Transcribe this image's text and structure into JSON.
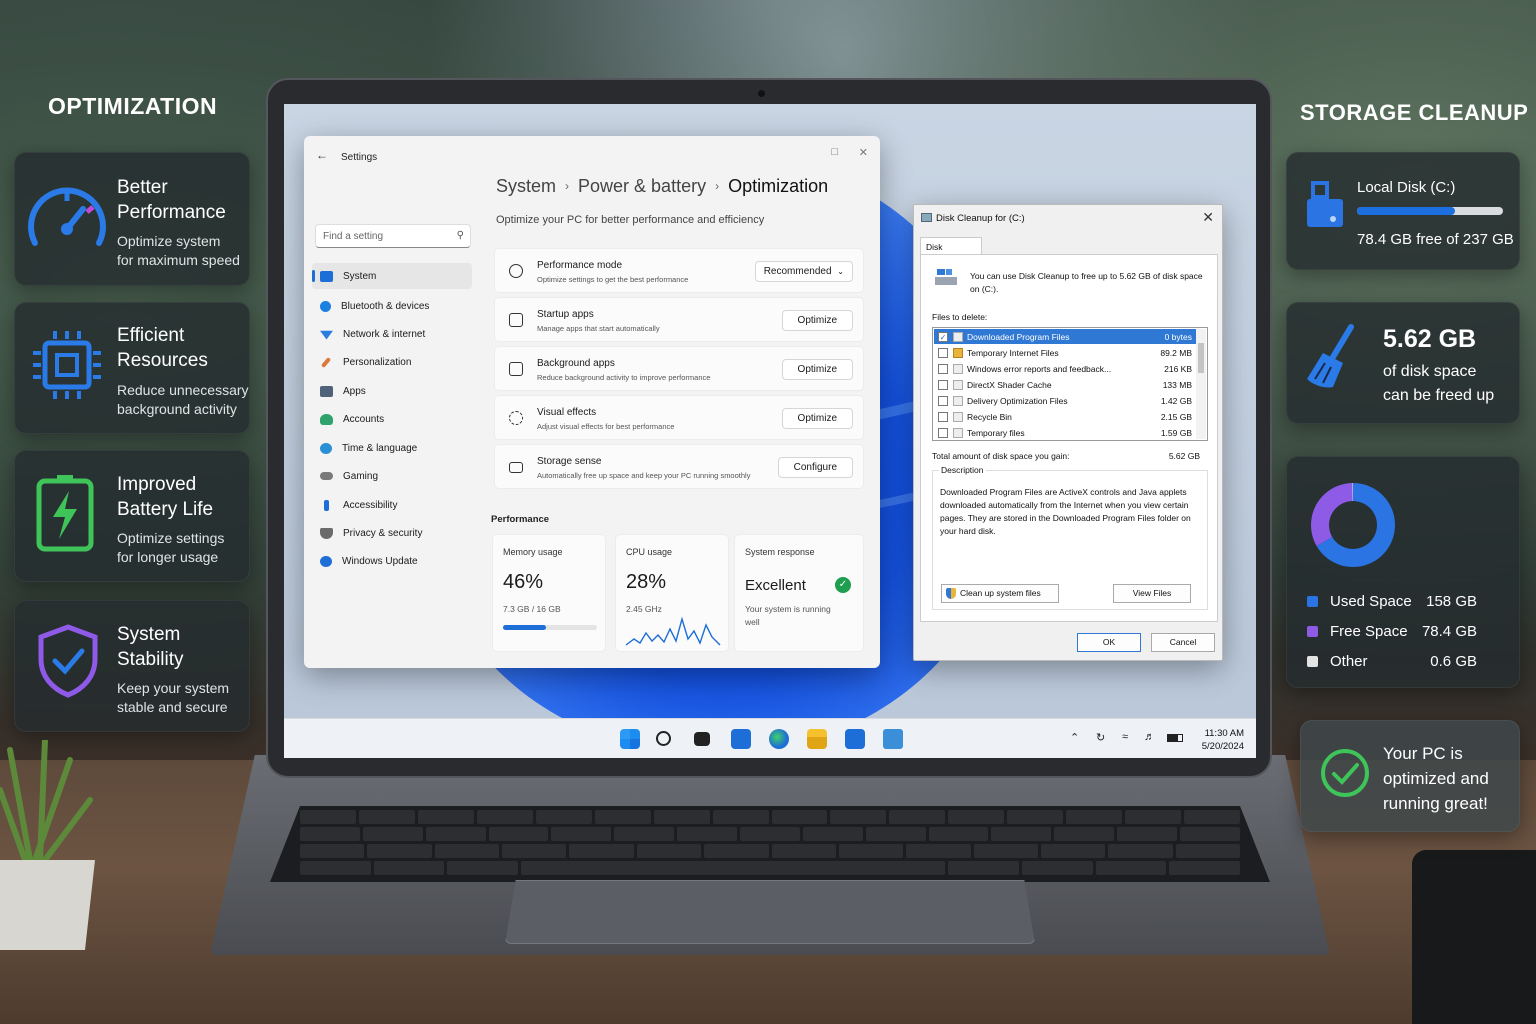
{
  "left_panel": {
    "title": "OPTIMIZATION",
    "cards": [
      {
        "title_line1": "Better",
        "title_line2": "Performance",
        "sub_line1": "Optimize system",
        "sub_line2": "for maximum speed",
        "icon": "speedometer-icon"
      },
      {
        "title_line1": "Efficient",
        "title_line2": "Resources",
        "sub_line1": "Reduce unnecessary",
        "sub_line2": "background activity",
        "icon": "cpu-chip-icon"
      },
      {
        "title_line1": "Improved",
        "title_line2": "Battery Life",
        "sub_line1": "Optimize settings",
        "sub_line2": "for longer usage",
        "icon": "battery-bolt-icon"
      },
      {
        "title_line1": "System",
        "title_line2": "Stability",
        "sub_line1": "Keep your system",
        "sub_line2": "stable and secure",
        "icon": "shield-check-icon"
      }
    ]
  },
  "right_panel": {
    "title": "STORAGE CLEANUP",
    "local_disk": {
      "label": "Local Disk (C:)",
      "used_fraction": 0.67,
      "free_text": "78.4 GB free of 237 GB"
    },
    "freeable": {
      "amount": "5.62 GB",
      "line1": "of disk space",
      "line2": "can be freed up"
    },
    "donut": {
      "legend": [
        {
          "name": "Used Space",
          "value": "158 GB",
          "gb": 158,
          "color": "#2a74e4"
        },
        {
          "name": "Free Space",
          "value": "78.4 GB",
          "gb": 78.4,
          "color": "#8d5be6"
        },
        {
          "name": "Other",
          "value": "0.6 GB",
          "gb": 0.6,
          "color": "#e3e3e3"
        }
      ]
    },
    "status": {
      "line1": "Your PC is",
      "line2": "optimized and",
      "line3": "running great!"
    }
  },
  "settings": {
    "window_title": "Settings",
    "search_placeholder": "Find a setting",
    "nav": [
      {
        "label": "System",
        "color": "#1d6ed6"
      },
      {
        "label": "Bluetooth & devices",
        "color": "#1d7fe0"
      },
      {
        "label": "Network & internet",
        "color": "#2b7de0"
      },
      {
        "label": "Personalization",
        "color": "#d97a3a"
      },
      {
        "label": "Apps",
        "color": "#50617a"
      },
      {
        "label": "Accounts",
        "color": "#2fa36b"
      },
      {
        "label": "Time & language",
        "color": "#2b8fd6"
      },
      {
        "label": "Gaming",
        "color": "#7a7a7a"
      },
      {
        "label": "Accessibility",
        "color": "#1d6ed6"
      },
      {
        "label": "Privacy & security",
        "color": "#6b6b6b"
      },
      {
        "label": "Windows Update",
        "color": "#1d6ed6"
      }
    ],
    "breadcrumb": {
      "a": "System",
      "b": "Power & battery",
      "c": "Optimization"
    },
    "subtitle": "Optimize your PC for better performance and efficiency",
    "rows": [
      {
        "title": "Performance mode",
        "sub": "Optimize settings to get the best performance",
        "button": "Recommended"
      },
      {
        "title": "Startup apps",
        "sub": "Manage apps that start automatically",
        "button": "Optimize"
      },
      {
        "title": "Background apps",
        "sub": "Reduce background activity to improve performance",
        "button": "Optimize"
      },
      {
        "title": "Visual effects",
        "sub": "Adjust visual effects for best performance",
        "button": "Optimize"
      },
      {
        "title": "Storage sense",
        "sub": "Automatically free up space and keep your PC running smoothly",
        "button": "Configure"
      }
    ],
    "performance_label": "Performance",
    "memory": {
      "label": "Memory usage",
      "value": "46%",
      "detail": "7.3 GB / 16 GB",
      "fraction": 0.46
    },
    "cpu": {
      "label": "CPU usage",
      "value": "28%",
      "detail": "2.45 GHz"
    },
    "response": {
      "label": "System response",
      "value": "Excellent",
      "detail": "Your system is running well"
    }
  },
  "disk_cleanup": {
    "title": "Disk Cleanup for  (C:)",
    "tab": "Disk Cleanup",
    "intro": "You can use Disk Cleanup to free up to 5.62 GB of disk space on  (C:).",
    "files_label": "Files to delete:",
    "files": [
      {
        "name": "Downloaded Program Files",
        "size": "0 bytes",
        "checked": true
      },
      {
        "name": "Temporary Internet Files",
        "size": "89.2 MB",
        "checked": false
      },
      {
        "name": "Windows error reports and feedback...",
        "size": "216 KB",
        "checked": false
      },
      {
        "name": "DirectX Shader Cache",
        "size": "133 MB",
        "checked": false
      },
      {
        "name": "Delivery Optimization Files",
        "size": "1.42 GB",
        "checked": false
      },
      {
        "name": "Recycle Bin",
        "size": "2.15 GB",
        "checked": false
      },
      {
        "name": "Temporary files",
        "size": "1.59 GB",
        "checked": false
      }
    ],
    "total_label": "Total amount of disk space you gain:",
    "total_value": "5.62 GB",
    "description_label": "Description",
    "description": "Downloaded Program Files are ActiveX controls and Java applets downloaded automatically from the Internet when you view certain pages. They are stored in the Downloaded Program Files folder on your hard disk.",
    "cleanup_system_label": "Clean up system files",
    "view_files_label": "View Files",
    "ok_label": "OK",
    "cancel_label": "Cancel"
  },
  "taskbar": {
    "time": "11:30 AM",
    "date": "5/20/2024"
  }
}
